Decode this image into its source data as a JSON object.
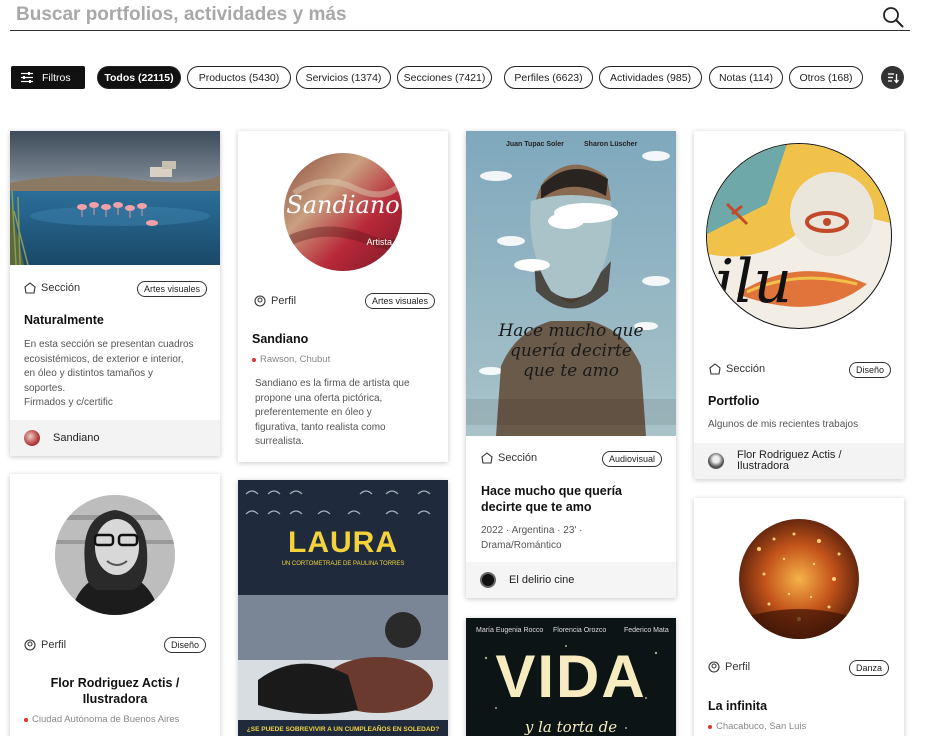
{
  "search": {
    "placeholder": "Buscar portfolios, actividades y más"
  },
  "filters": {
    "filtros_label": "Filtros",
    "chips": [
      {
        "label": "Todos (22115)",
        "active": true
      },
      {
        "label": "Productos (5430)"
      },
      {
        "label": "Servicios (1374)"
      },
      {
        "label": "Secciones (7421)"
      },
      {
        "label": "Perfiles (6623)"
      },
      {
        "label": "Actividades (985)"
      },
      {
        "label": "Notas (114)"
      },
      {
        "label": "Otros (168)"
      }
    ]
  },
  "cards": {
    "naturalmente": {
      "type": "Sección",
      "badge": "Artes visuales",
      "title": "Naturalmente",
      "desc": [
        "En esta sección se presentan cuadros",
        "ecosistémicos, de exterior e interior,",
        "en óleo y distintos tamaños y",
        "soportes.",
        "Firmados y c/certific"
      ],
      "owner": "Sandiano"
    },
    "sandiano": {
      "type": "Perfil",
      "badge": "Artes visuales",
      "title": "Sandiano",
      "location": "Rawson, Chubut",
      "desc": [
        "Sandiano es la firma de artista que",
        "propone una oferta pictórica,",
        "preferentemente en óleo y",
        "figurativa, tanto realista como",
        "surrealista."
      ],
      "logo_script": "Sandiano",
      "logo_tag": "Artista"
    },
    "hace_mucho": {
      "poster_credits": [
        "Juan Tupac Soler",
        "Sharon Lüscher"
      ],
      "poster_title": [
        "Hace mucho que",
        "quería decirte",
        "que te amo"
      ],
      "type": "Sección",
      "badge": "Audiovisual",
      "title": [
        "Hace mucho que quería",
        "decirte que te amo"
      ],
      "desc": [
        "2022 · Argentina · 23' ·",
        "Drama/Romántico"
      ],
      "owner": "El delirio cine"
    },
    "portfolio": {
      "logo_text": "ilu",
      "type": "Sección",
      "badge": "Diseño",
      "title": "Portfolio",
      "desc": "Algunos de mis recientes trabajos",
      "owner": [
        "Flor Rodriguez Actis /",
        "Ilustradora"
      ]
    },
    "flor": {
      "type": "Perfil",
      "badge": "Diseño",
      "title": [
        "Flor Rodriguez Actis /",
        "Ilustradora"
      ],
      "location": "Ciudad Autónoma de Buenos Aires"
    },
    "laura": {
      "poster_title": "LAURA",
      "poster_sub": "UN CORTOMETRAJE DE PAULINA TORRES",
      "poster_tagline": "¿SE PUEDE SOBREVIVIR A UN CUMPLEAÑOS EN SOLEDAD?"
    },
    "vida": {
      "credits": [
        "María Eugenia Rocco",
        "Florencia Orozco",
        "Federico Mata"
      ],
      "poster_title": "VIDA",
      "poster_sub": "y la torta de"
    },
    "infinita": {
      "type": "Perfil",
      "badge": "Danza",
      "title": "La infinita",
      "location": "Chacabuco, San Luis"
    }
  },
  "colors": {
    "accent_dark": "#111111",
    "location_dot": "#dd3333",
    "footer_bg": "#f3f3f3"
  }
}
